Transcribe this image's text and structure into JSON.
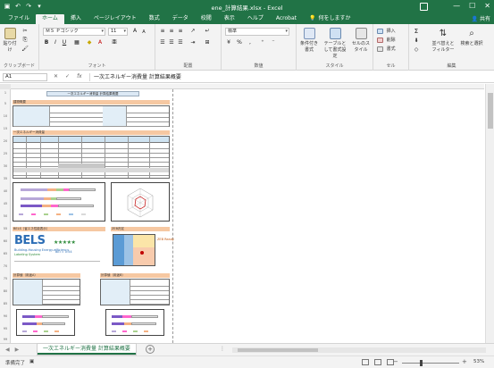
{
  "window": {
    "title": "ene_計算結果.xlsx - Excel",
    "minimize": "—",
    "maximize": "☐",
    "close": "✕"
  },
  "ribbon_tabs": [
    {
      "label": "ファイル"
    },
    {
      "label": "ホーム"
    },
    {
      "label": "挿入"
    },
    {
      "label": "ページレイアウト"
    },
    {
      "label": "数式"
    },
    {
      "label": "データ"
    },
    {
      "label": "校閲"
    },
    {
      "label": "表示"
    },
    {
      "label": "ヘルプ"
    },
    {
      "label": "Acrobat"
    }
  ],
  "tell_me": "何をしますか",
  "share": "共有",
  "ribbon": {
    "clipboard": {
      "paste": "貼り付け",
      "label": "クリップボード"
    },
    "font": {
      "name": "ＭＳ Ｐゴシック",
      "size": "11",
      "label": "フォント",
      "bold": "B",
      "italic": "I",
      "underline": "U",
      "grow": "A",
      "shrink": "A"
    },
    "alignment": {
      "label": "配置"
    },
    "number": {
      "format": "標準",
      "label": "数値",
      "percent": "%",
      "comma": ","
    },
    "styles": {
      "conditional": "条件付き書式",
      "table": "テーブルとして書式設定",
      "cell": "セルのスタイル",
      "label": "スタイル"
    },
    "cells": {
      "insert": "挿入",
      "delete": "削除",
      "format": "書式",
      "label": "セル"
    },
    "editing": {
      "sort": "並べ替えとフィルター",
      "find": "検索と選択",
      "label": "編集",
      "sum": "Σ"
    }
  },
  "formula_bar": {
    "name_box": "A1",
    "fx": "fx",
    "content": "一次エネルギー消費量 計算結果概要"
  },
  "sheet": {
    "title": "一次エネルギー消費量 計算結果概要",
    "sections": {
      "building": "建物概要",
      "energy": "一次エネルギー消費量",
      "bels": "BELS（省エネ性能表示）",
      "zeb": "ZEB判定",
      "calc_a": "計算値（用途A）",
      "calc_b": "計算値（用途B）"
    },
    "bels": {
      "logo": "BELS",
      "line1": "Building-Housing Energy-efficiency",
      "line2": "Labeling System",
      "stars": "★★★★★",
      "bei_value": "BEI = 0.54"
    },
    "zeb_label": "ZEB Ready"
  },
  "sheet_tab": "一次エネルギー消費量 計算結果概要",
  "statusbar": {
    "ready": "準備完了",
    "zoom": "53%"
  },
  "colors": {
    "excel_green": "#217346",
    "section_orange": "#f6c8a2",
    "header_blue": "#cfe3f1"
  }
}
